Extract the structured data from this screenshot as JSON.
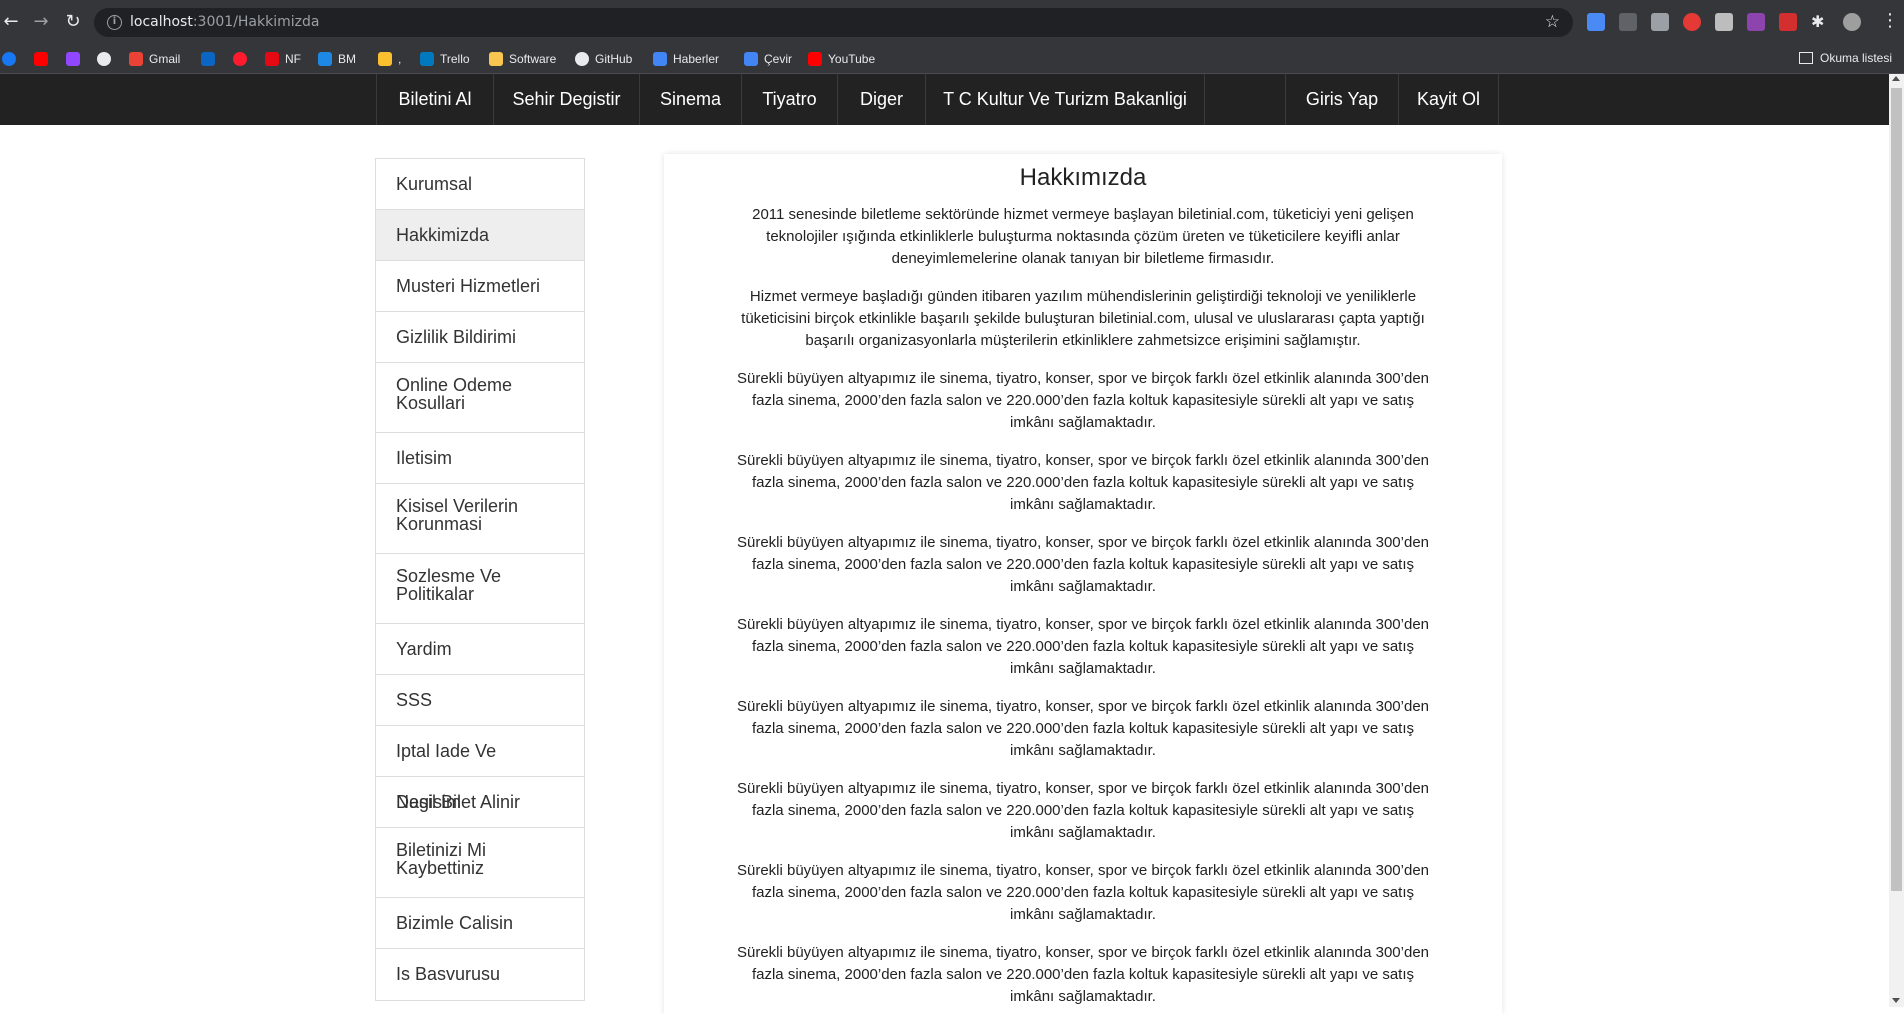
{
  "browser": {
    "url_host": "localhost",
    "url_path": ":3001/Hakkimizda",
    "bookmarks": [
      {
        "label": ""
      },
      {
        "label": ""
      },
      {
        "label": ""
      },
      {
        "label": ""
      },
      {
        "label": "Gmail"
      },
      {
        "label": ""
      },
      {
        "label": ""
      },
      {
        "label": "NF"
      },
      {
        "label": "BM"
      },
      {
        "label": ","
      },
      {
        "label": "Trello"
      },
      {
        "label": "Software"
      },
      {
        "label": "GitHub"
      },
      {
        "label": "Haberler"
      },
      {
        "label": "Çevir"
      },
      {
        "label": "YouTube"
      }
    ],
    "reading_list": "Okuma listesi"
  },
  "nav": {
    "items": [
      "Biletini Al",
      "Sehir Degistir",
      "Sinema",
      "Tiyatro",
      "Diger",
      "T C Kultur Ve Turizm Bakanligi"
    ],
    "login": "Giris Yap",
    "register": "Kayit Ol"
  },
  "sidebar": {
    "items": [
      {
        "label": "Kurumsal"
      },
      {
        "label": "Hakkimizda",
        "active": true
      },
      {
        "label": "Musteri Hizmetleri"
      },
      {
        "label": "Gizlilik Bildirimi"
      },
      {
        "label": "Online Odeme Kosullari"
      },
      {
        "label": "Iletisim"
      },
      {
        "label": "Kisisel Verilerin Korunmasi"
      },
      {
        "label": "Sozlesme Ve Politikalar"
      },
      {
        "label": "Yardim"
      },
      {
        "label": "SSS"
      },
      {
        "label": "Iptal Iade Ve Degisim"
      },
      {
        "label": "Nasil Bilet Alinir"
      },
      {
        "label": "Biletinizi Mi Kaybettiniz"
      },
      {
        "label": "Bizimle Calisin"
      },
      {
        "label": "Is Basvurusu"
      }
    ]
  },
  "content": {
    "title": "Hakkımızda",
    "paragraphs": [
      "2011 senesinde biletleme sektöründe hizmet vermeye başlayan biletinial.com, tüketiciyi yeni gelişen teknolojiler ışığında etkinliklerle buluşturma noktasında çözüm üreten ve tüketicilere keyifli anlar deneyimlemelerine olanak tanıyan bir biletleme firmasıdır.",
      "Hizmet vermeye başladığı günden itibaren yazılım mühendislerinin geliştirdiği teknoloji ve yeniliklerle tüketicisini birçok etkinlikle başarılı şekilde buluşturan biletinial.com, ulusal ve uluslararası çapta yaptığı başarılı organizasyonlarla müşterilerin etkinliklere zahmetsizce erişimini sağlamıştır.",
      "Sürekli büyüyen altyapımız ile sinema, tiyatro, konser, spor ve birçok farklı özel etkinlik alanında 300’den fazla sinema, 2000’den fazla salon ve 220.000’den fazla koltuk kapasitesiyle sürekli alt yapı ve satış imkânı sağlamaktadır.",
      "Sürekli büyüyen altyapımız ile sinema, tiyatro, konser, spor ve birçok farklı özel etkinlik alanında 300’den fazla sinema, 2000’den fazla salon ve 220.000’den fazla koltuk kapasitesiyle sürekli alt yapı ve satış imkânı sağlamaktadır.",
      "Sürekli büyüyen altyapımız ile sinema, tiyatro, konser, spor ve birçok farklı özel etkinlik alanında 300’den fazla sinema, 2000’den fazla salon ve 220.000’den fazla koltuk kapasitesiyle sürekli alt yapı ve satış imkânı sağlamaktadır.",
      "Sürekli büyüyen altyapımız ile sinema, tiyatro, konser, spor ve birçok farklı özel etkinlik alanında 300’den fazla sinema, 2000’den fazla salon ve 220.000’den fazla koltuk kapasitesiyle sürekli alt yapı ve satış imkânı sağlamaktadır.",
      "Sürekli büyüyen altyapımız ile sinema, tiyatro, konser, spor ve birçok farklı özel etkinlik alanında 300’den fazla sinema, 2000’den fazla salon ve 220.000’den fazla koltuk kapasitesiyle sürekli alt yapı ve satış imkânı sağlamaktadır.",
      "Sürekli büyüyen altyapımız ile sinema, tiyatro, konser, spor ve birçok farklı özel etkinlik alanında 300’den fazla sinema, 2000’den fazla salon ve 220.000’den fazla koltuk kapasitesiyle sürekli alt yapı ve satış imkânı sağlamaktadır.",
      "Sürekli büyüyen altyapımız ile sinema, tiyatro, konser, spor ve birçok farklı özel etkinlik alanında 300’den fazla sinema, 2000’den fazla salon ve 220.000’den fazla koltuk kapasitesiyle sürekli alt yapı ve satış imkânı sağlamaktadır.",
      "Sürekli büyüyen altyapımız ile sinema, tiyatro, konser, spor ve birçok farklı özel etkinlik alanında 300’den fazla sinema, 2000’den fazla salon ve 220.000’den fazla koltuk kapasitesiyle sürekli alt yapı ve satış imkânı sağlamaktadır."
    ]
  },
  "colors": {
    "chrome": "#35363a",
    "omnibox": "#202124",
    "navbar": "#222222",
    "active_item": "#eeeeee"
  }
}
